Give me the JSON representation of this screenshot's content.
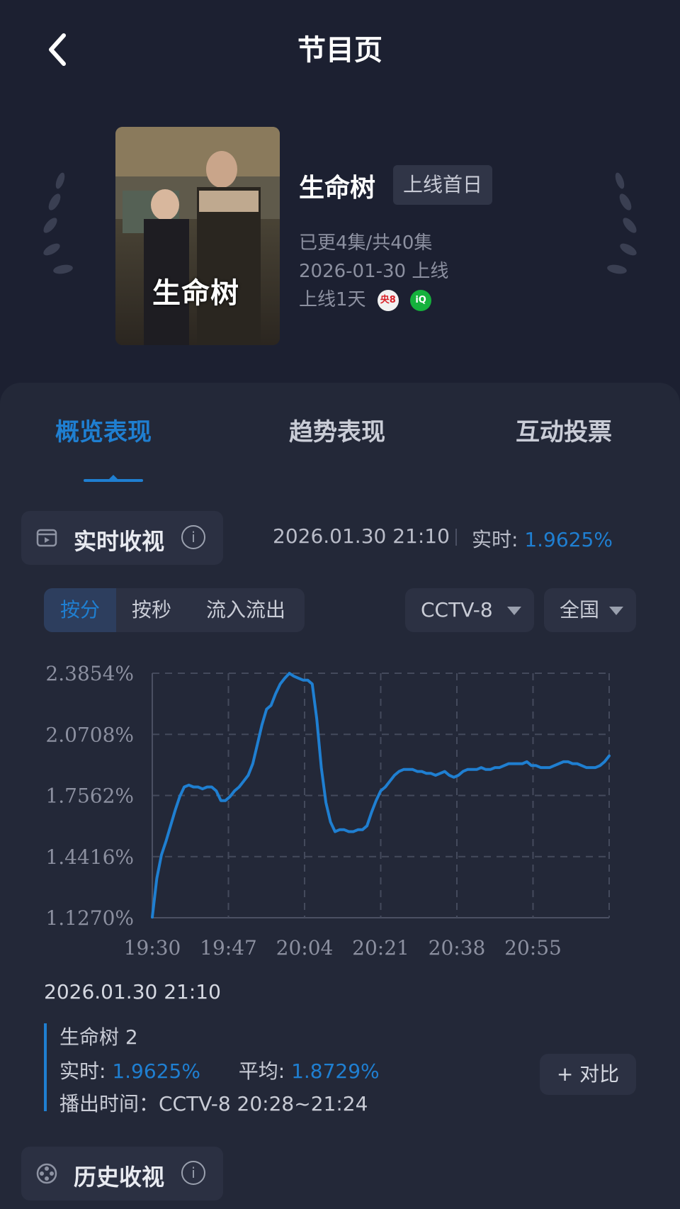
{
  "header": {
    "title": "节目页",
    "back_icon": "chevron-left-icon"
  },
  "show": {
    "poster_title": "生命树",
    "name": "生命树",
    "tag": "上线首日",
    "episodes": "已更4集/共40集",
    "release": "2026-01-30 上线",
    "online_days": "上线1天",
    "platforms": [
      {
        "name": "CCTV-8",
        "label": "央8",
        "icon": "cctv8-logo-icon"
      },
      {
        "name": "iQIYI",
        "label": "iQIYI",
        "icon": "iqiyi-logo-icon"
      }
    ]
  },
  "tabs": [
    {
      "label": "概览表现",
      "active": true
    },
    {
      "label": "趋势表现",
      "active": false
    },
    {
      "label": "互动投票",
      "active": false
    }
  ],
  "realtime": {
    "section_label": "实时收视",
    "timestamp": "2026.01.30 21:10",
    "label": "实时:",
    "value": "1.9625%"
  },
  "segments": [
    {
      "label": "按分",
      "active": true
    },
    {
      "label": "按秒",
      "active": false
    },
    {
      "label": "流入流出",
      "active": false
    }
  ],
  "filters": {
    "channel": "CCTV-8",
    "region": "全国"
  },
  "chart_data": {
    "type": "line",
    "title": "",
    "xlabel": "",
    "ylabel": "",
    "y_ticks": [
      "2.3854%",
      "2.0708%",
      "1.7562%",
      "1.4416%",
      "1.1270%"
    ],
    "ylim": [
      1.127,
      2.3854
    ],
    "x_ticks": [
      "19:30",
      "19:47",
      "20:04",
      "20:21",
      "20:38",
      "20:55"
    ],
    "x_minutes_range": [
      0,
      100
    ],
    "grid": true,
    "line_color": "#1f7fd1",
    "series": [
      {
        "name": "",
        "x": [
          0,
          1,
          2,
          3,
          4,
          5,
          6,
          7,
          8,
          9,
          10,
          11,
          12,
          13,
          14,
          15,
          16,
          17,
          18,
          19,
          20,
          21,
          22,
          23,
          24,
          25,
          26,
          27,
          28,
          29,
          30,
          31,
          32,
          33,
          34,
          35,
          36,
          37,
          38,
          39,
          40,
          41,
          42,
          43,
          44,
          45,
          46,
          47,
          48,
          49,
          50,
          51,
          52,
          53,
          54,
          55,
          56,
          57,
          58,
          59,
          60,
          61,
          62,
          63,
          64,
          65,
          66,
          67,
          68,
          69,
          70,
          71,
          72,
          73,
          74,
          75,
          76,
          77,
          78,
          79,
          80,
          81,
          82,
          83,
          84,
          85,
          86,
          87,
          88,
          89,
          90,
          91,
          92,
          93,
          94,
          95,
          96,
          97,
          98,
          99,
          100
        ],
        "y": [
          1.13,
          1.33,
          1.45,
          1.52,
          1.6,
          1.68,
          1.75,
          1.8,
          1.81,
          1.8,
          1.8,
          1.79,
          1.8,
          1.8,
          1.78,
          1.73,
          1.73,
          1.75,
          1.78,
          1.8,
          1.83,
          1.86,
          1.92,
          2.02,
          2.12,
          2.2,
          2.22,
          2.28,
          2.33,
          2.36,
          2.385,
          2.37,
          2.36,
          2.35,
          2.35,
          2.33,
          2.15,
          1.9,
          1.72,
          1.62,
          1.57,
          1.58,
          1.58,
          1.57,
          1.57,
          1.58,
          1.58,
          1.6,
          1.67,
          1.73,
          1.78,
          1.8,
          1.83,
          1.86,
          1.88,
          1.89,
          1.89,
          1.89,
          1.88,
          1.88,
          1.87,
          1.87,
          1.86,
          1.87,
          1.88,
          1.86,
          1.85,
          1.86,
          1.88,
          1.89,
          1.89,
          1.89,
          1.9,
          1.89,
          1.89,
          1.9,
          1.9,
          1.91,
          1.92,
          1.92,
          1.92,
          1.92,
          1.93,
          1.91,
          1.91,
          1.9,
          1.9,
          1.9,
          1.91,
          1.92,
          1.93,
          1.93,
          1.92,
          1.92,
          1.91,
          1.9,
          1.9,
          1.9,
          1.91,
          1.93,
          1.96
        ]
      }
    ]
  },
  "selection": {
    "timestamp": "2026.01.30 21:10",
    "program": "生命树 2",
    "realtime_label": "实时:",
    "realtime_value": "1.9625%",
    "average_label": "平均:",
    "average_value": "1.8729%",
    "airtime": "播出时间：CCTV-8 20:28~21:24",
    "compare_label": "+ 对比"
  },
  "history": {
    "section_label": "历史收视"
  }
}
